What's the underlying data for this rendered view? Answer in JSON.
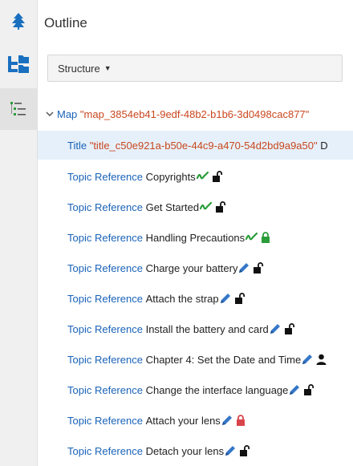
{
  "sidebar": {
    "items": [
      {
        "name": "tree-icon",
        "active": false
      },
      {
        "name": "folder-icon",
        "active": false
      },
      {
        "name": "outline-list-icon",
        "active": true
      }
    ]
  },
  "panel": {
    "title": "Outline",
    "structure_select": {
      "value": "Structure"
    }
  },
  "tree": {
    "root": {
      "keyword": "Map",
      "value": "\"map_3854eb41-9edf-48b2-b1b6-3d0498cac877\""
    },
    "title_row": {
      "keyword": "Title",
      "value": "\"title_c50e921a-b50e-44c9-a470-54d2bd9a9a50\"",
      "trailing": "D"
    },
    "items": [
      {
        "keyword": "Topic Reference",
        "text": "Copyrights",
        "status": "green-check",
        "lock": "unlocked"
      },
      {
        "keyword": "Topic Reference",
        "text": "Get Started",
        "status": "green-check",
        "lock": "unlocked"
      },
      {
        "keyword": "Topic Reference",
        "text": "Handling Precautions",
        "status": "green-check",
        "lock": "locked-green"
      },
      {
        "keyword": "Topic Reference",
        "text": "Charge your battery",
        "status": "pencil",
        "lock": "unlocked"
      },
      {
        "keyword": "Topic Reference",
        "text": "Attach the strap",
        "status": "pencil",
        "lock": "unlocked"
      },
      {
        "keyword": "Topic Reference",
        "text": "Install the battery and card",
        "status": "pencil",
        "lock": "unlocked"
      },
      {
        "keyword": "Topic Reference",
        "text": "Chapter 4: Set the Date and Time",
        "status": "pencil",
        "lock": "user"
      },
      {
        "keyword": "Topic Reference",
        "text": "Change the interface language",
        "status": "pencil",
        "lock": "unlocked"
      },
      {
        "keyword": "Topic Reference",
        "text": "Attach your lens",
        "status": "pencil",
        "lock": "locked-red"
      },
      {
        "keyword": "Topic Reference",
        "text": "Detach your lens",
        "status": "pencil",
        "lock": "unlocked"
      }
    ]
  },
  "colors": {
    "keyword": "#1a63b8",
    "value": "#c9471f",
    "selected_row": "#e6f0fa",
    "accent_green": "#2a9d3a",
    "pencil": "#3477c8",
    "lock_red": "#d9444a"
  }
}
